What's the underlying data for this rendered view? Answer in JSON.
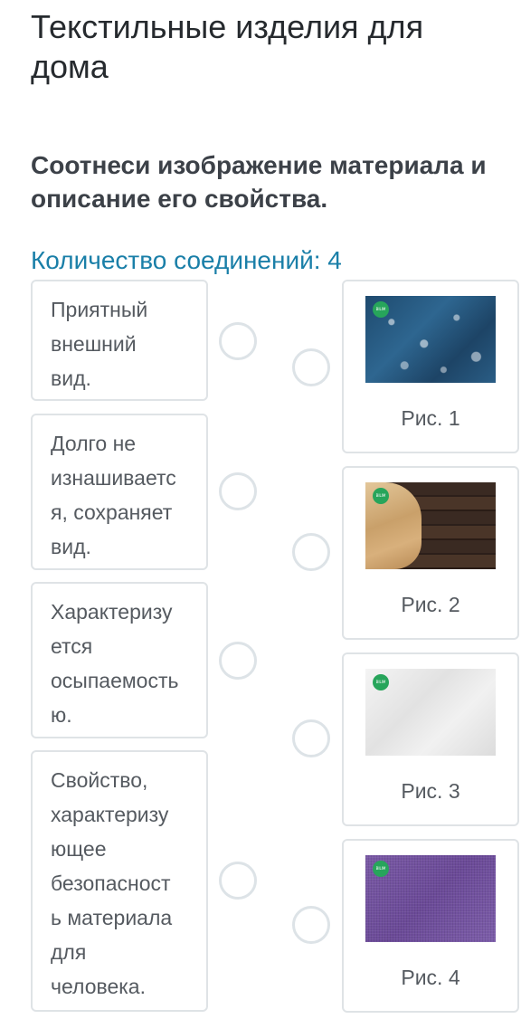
{
  "page": {
    "title": "Текстильные изделия для дома",
    "question": "Соотнеси изображение материала и описание его свойства.",
    "connections_count": "Количество соединений: 4"
  },
  "left_items": [
    {
      "lines": [
        "Приятный",
        "внешний",
        "вид."
      ]
    },
    {
      "lines": [
        "Долго не",
        "изнашиваетс",
        "я, сохраняет",
        "вид."
      ]
    },
    {
      "lines": [
        "Характеризу",
        "ется",
        "осыпаемость",
        "ю."
      ]
    },
    {
      "lines": [
        "Свойство,",
        "характеризу",
        "ющее",
        "безопасност",
        "ь материала",
        "для",
        "человека."
      ]
    }
  ],
  "right_items": [
    {
      "caption": "Рис. 1",
      "image": "water-drops-fabric"
    },
    {
      "caption": "Рис. 2",
      "image": "burlap-on-wood"
    },
    {
      "caption": "Рис. 3",
      "image": "white-crumpled-fabric"
    },
    {
      "caption": "Рис. 4",
      "image": "purple-woven-fabric"
    }
  ],
  "badge_text": "BILIM Land",
  "colors": {
    "accent": "#1a7fa8",
    "border": "#dfe3e6",
    "badge": "#27a55b"
  }
}
